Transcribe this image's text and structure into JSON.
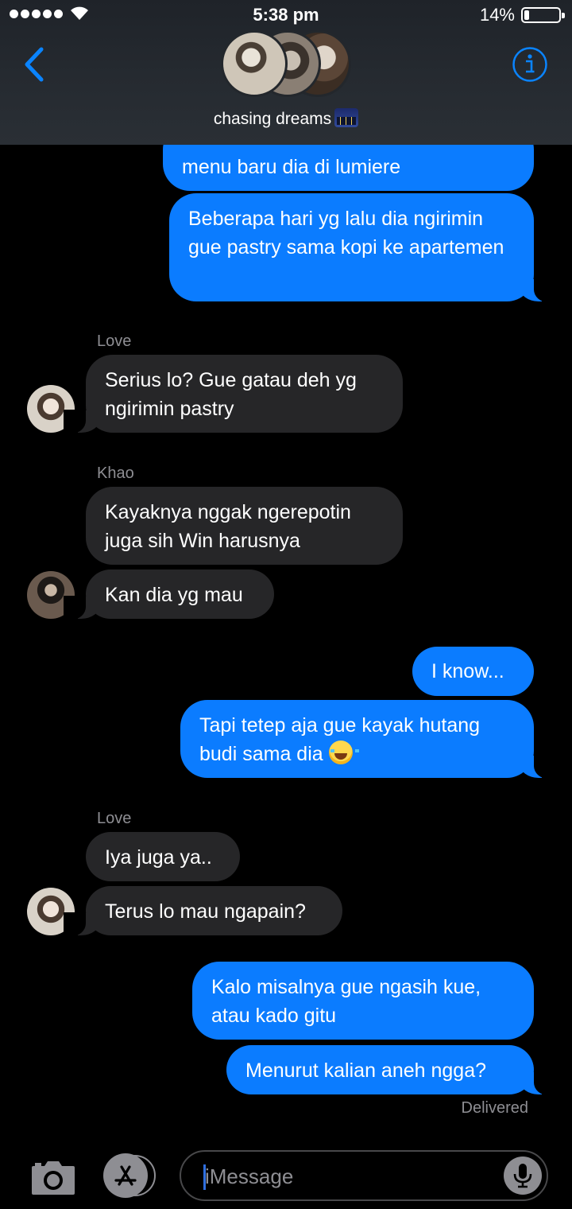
{
  "status_bar": {
    "time": "5:38 pm",
    "battery_percent_label": "14%",
    "battery_level": 0.14
  },
  "header": {
    "group_name": "chasing dreams",
    "group_emoji": "night-city-icon"
  },
  "messages": [
    {
      "id": "m1",
      "direction": "out",
      "text": "menu baru dia di lumiere"
    },
    {
      "id": "m2",
      "direction": "out",
      "text": "Beberapa hari yg lalu dia ngirimin gue pastry sama kopi ke apartemen"
    },
    {
      "id": "s1",
      "sender": "Love"
    },
    {
      "id": "m3",
      "direction": "in",
      "text": "Serius lo? Gue gatau deh yg ngirimin pastry"
    },
    {
      "id": "s2",
      "sender": "Khao"
    },
    {
      "id": "m4",
      "direction": "in",
      "text": "Kayaknya nggak ngerepotin juga sih Win harusnya"
    },
    {
      "id": "m5",
      "direction": "in",
      "text": "Kan dia yg mau"
    },
    {
      "id": "m6",
      "direction": "out",
      "text": "I know..."
    },
    {
      "id": "m7",
      "direction": "out",
      "text": "Tapi tetep aja gue kayak hutang budi sama dia",
      "emoji": "face-with-tears-of-joy"
    },
    {
      "id": "s3",
      "sender": "Love"
    },
    {
      "id": "m8",
      "direction": "in",
      "text": "Iya juga ya.."
    },
    {
      "id": "m9",
      "direction": "in",
      "text": "Terus lo mau ngapain?"
    },
    {
      "id": "m10",
      "direction": "out",
      "text": "Kalo misalnya gue ngasih kue, atau kado gitu"
    },
    {
      "id": "m11",
      "direction": "out",
      "text": "Menurut kalian aneh ngga?"
    }
  ],
  "delivery_status": "Delivered",
  "input_bar": {
    "placeholder": "iMessage",
    "value": ""
  },
  "colors": {
    "outgoing_bubble": "#0b7cff",
    "incoming_bubble": "#262628",
    "accent": "#0a84ff"
  }
}
